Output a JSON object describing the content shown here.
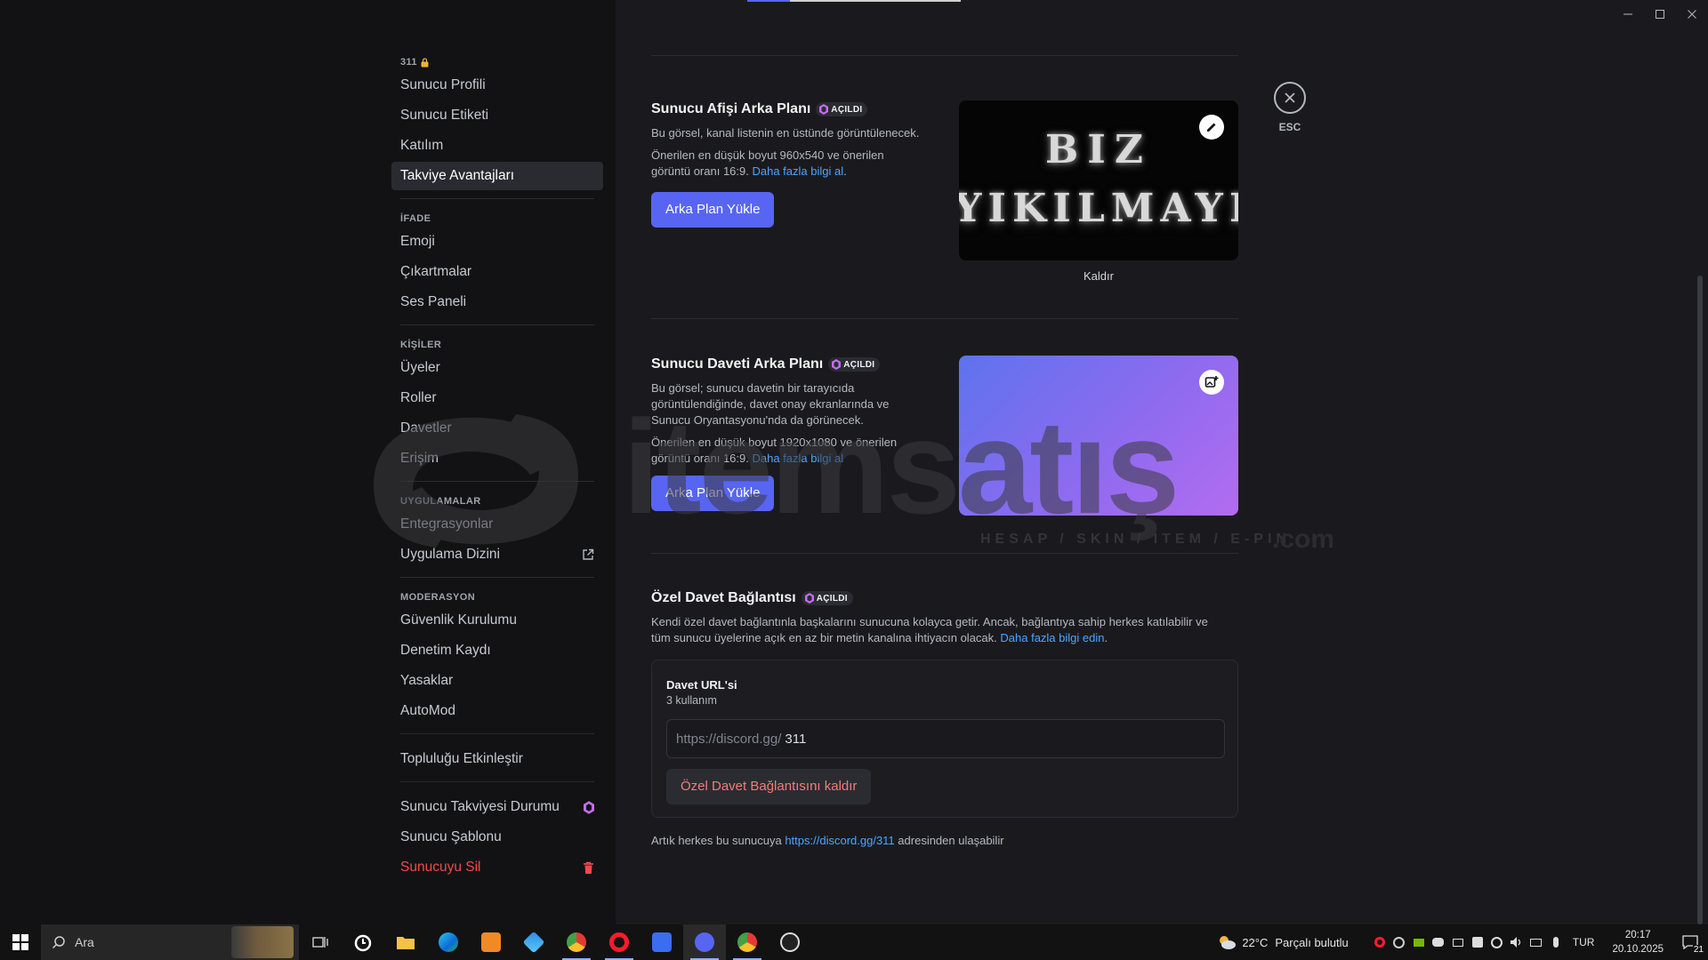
{
  "sidebar": {
    "server_header": "311",
    "sections": [
      {
        "title": "",
        "items": [
          {
            "label": "Sunucu Profili",
            "name": "sidebar-item-server-profile"
          },
          {
            "label": "Sunucu Etiketi",
            "name": "sidebar-item-server-tag"
          },
          {
            "label": "Katılım",
            "name": "sidebar-item-onboarding"
          },
          {
            "label": "Takviye Avantajları",
            "name": "sidebar-item-boost-perks",
            "active": true
          }
        ]
      },
      {
        "title": "İFADE",
        "items": [
          {
            "label": "Emoji",
            "name": "sidebar-item-emoji"
          },
          {
            "label": "Çıkartmalar",
            "name": "sidebar-item-stickers"
          },
          {
            "label": "Ses Paneli",
            "name": "sidebar-item-soundboard"
          }
        ]
      },
      {
        "title": "KİŞİLER",
        "items": [
          {
            "label": "Üyeler",
            "name": "sidebar-item-members"
          },
          {
            "label": "Roller",
            "name": "sidebar-item-roles"
          },
          {
            "label": "Davetler",
            "name": "sidebar-item-invites"
          },
          {
            "label": "Erişim",
            "name": "sidebar-item-access"
          }
        ]
      },
      {
        "title": "UYGULAMALAR",
        "items": [
          {
            "label": "Entegrasyonlar",
            "name": "sidebar-item-integrations"
          },
          {
            "label": "Uygulama Dizini",
            "name": "sidebar-item-app-directory",
            "icon": "external-link-icon"
          }
        ]
      },
      {
        "title": "MODERASYON",
        "items": [
          {
            "label": "Güvenlik Kurulumu",
            "name": "sidebar-item-safety-setup"
          },
          {
            "label": "Denetim Kaydı",
            "name": "sidebar-item-audit-log"
          },
          {
            "label": "Yasaklar",
            "name": "sidebar-item-bans"
          },
          {
            "label": "AutoMod",
            "name": "sidebar-item-automod"
          }
        ]
      },
      {
        "title": "",
        "items": [
          {
            "label": "Topluluğu Etkinleştir",
            "name": "sidebar-item-enable-community"
          }
        ]
      },
      {
        "title": "",
        "items": [
          {
            "label": "Sunucu Takviyesi Durumu",
            "name": "sidebar-item-boost-status",
            "icon": "boost-gem-icon"
          },
          {
            "label": "Sunucu Şablonu",
            "name": "sidebar-item-server-template"
          },
          {
            "label": "Sunucuyu Sil",
            "name": "sidebar-item-delete-server",
            "icon": "trash-icon",
            "danger": true
          }
        ]
      }
    ]
  },
  "banner": {
    "title": "Sunucu Afişi Arka Planı",
    "badge": "AÇILDI",
    "desc1": "Bu görsel, kanal listenin en üstünde görüntülenecek.",
    "desc2_a": "Önerilen en düşük boyut 960x540 ve önerilen",
    "desc2_b": "görüntü oranı 16:9.",
    "link": "Daha fazla bilgi al",
    "link_suffix": ".",
    "button": "Arka Plan Yükle",
    "image_line1": "BIZ",
    "image_line2": "YIKILMAYIZ",
    "remove": "Kaldır"
  },
  "invite_bg": {
    "title": "Sunucu Daveti Arka Planı",
    "badge": "AÇILDI",
    "desc1_a": "Bu görsel; sunucu davetin bir tarayıcıda",
    "desc1_b": "görüntülendiğinde, davet onay ekranlarında ve",
    "desc1_c": "Sunucu Oryantasyonu'nda da görünecek.",
    "desc2_a": "Önerilen en düşük boyut 1920x1080 ve önerilen",
    "desc2_b": "görüntü oranı 16:9.",
    "link": "Daha fazla bilgi al",
    "button": "Arka Plan Yükle"
  },
  "vanity": {
    "title": "Özel Davet Bağlantısı",
    "badge": "AÇILDI",
    "desc_a": "Kendi özel davet bağlantınla başkalarını sunucuna kolayca getir. Ancak, bağlantıya sahip herkes katılabilir ve",
    "desc_b": "tüm sunucu üyelerine açık en az bir metin kanalına ihtiyacın olacak.",
    "link": "Daha fazla bilgi edin",
    "link_suffix": ".",
    "url_label": "Davet URL'si",
    "uses": "3 kullanım",
    "url_prefix": "https://discord.gg/",
    "url_value": "311",
    "remove_button": "Özel Davet Bağlantısını kaldır",
    "footer_a": "Artık herkes bu sunucuya",
    "footer_link": "https://discord.gg/311",
    "footer_b": "adresinden ulaşabilir"
  },
  "close": {
    "label": "ESC"
  },
  "watermark": {
    "text": "itemsatış",
    "sub": "HESAP / SKIN / ITEM / E-PIN",
    "com": ".com"
  },
  "taskbar": {
    "search_placeholder": "Ara",
    "weather_temp": "22°C",
    "weather_text": "Parçalı bulutlu",
    "lang": "TUR",
    "time": "20:17",
    "date": "20.10.2025",
    "notif_count": "21"
  },
  "colors": {
    "accent": "#5865f2",
    "danger": "#f04a4a",
    "link": "#4ea4ff",
    "boost": "#c46df2"
  }
}
